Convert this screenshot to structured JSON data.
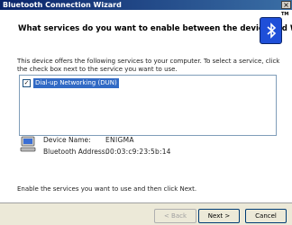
{
  "window": {
    "title": "Bluetooth Connection Wizard",
    "close_glyph": "×"
  },
  "header": {
    "question": "What services do you want to enable between the device and Windows?",
    "tm": "TM"
  },
  "body": {
    "description": "This device offers the following services to your computer. To select a service, click the check box next to the service you want to use.",
    "services": [
      {
        "label": "Dial-up Networking (DUN)",
        "checked": true
      }
    ],
    "device_name_label": "Device Name:",
    "device_name_value": "ENIGMA",
    "bt_address_label": "Bluetooth Address:",
    "bt_address_value": "00:03:c9:23:5b:14",
    "hint": "Enable the services you want to use and then click Next."
  },
  "buttons": {
    "back": "< Back",
    "next": "Next >",
    "cancel": "Cancel"
  },
  "colors": {
    "title_bar": "#0a246a",
    "selection": "#316ac5",
    "dialog_bg": "#ece9d8"
  }
}
